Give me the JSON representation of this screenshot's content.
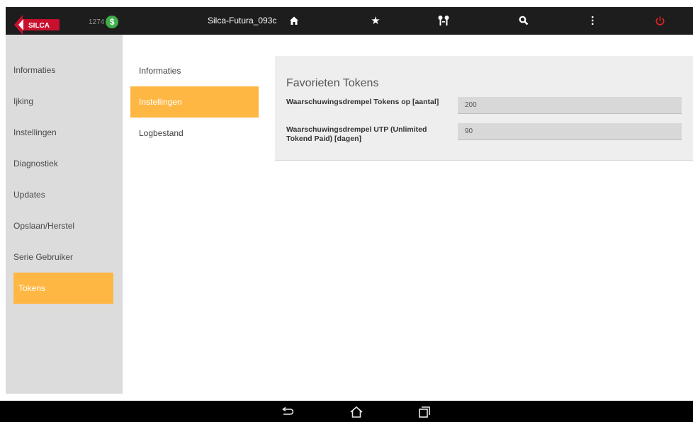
{
  "topbar": {
    "logo_text": "SILCA",
    "token_count": "1274",
    "coin_symbol": "$",
    "device_name": "Silca-Futura_093c",
    "icons": [
      "home-icon",
      "star-icon",
      "keys-icon",
      "search-icon",
      "more-vertical-icon",
      "power-icon"
    ],
    "glyphs": {
      "home": "🏠",
      "star": "★",
      "keys": "⚲⚲",
      "search": "🔍",
      "more": "⋮",
      "power": "⏻"
    },
    "power_color": "#e0221e"
  },
  "sidebar": {
    "items": [
      {
        "label": "Informaties"
      },
      {
        "label": "Ijking"
      },
      {
        "label": "Instellingen"
      },
      {
        "label": "Diagnostiek"
      },
      {
        "label": "Updates"
      },
      {
        "label": "Opslaan/Herstel"
      },
      {
        "label": "Serie Gebruiker"
      },
      {
        "label": "Tokens",
        "active": true
      }
    ]
  },
  "submenu": {
    "items": [
      {
        "label": "Informaties"
      },
      {
        "label": "Instellingen",
        "active": true
      },
      {
        "label": "Logbestand"
      }
    ]
  },
  "panel": {
    "title": "Favorieten Tokens",
    "fields": [
      {
        "label": "Waarschuwingsdrempel Tokens op [aantal]",
        "value": "200"
      },
      {
        "label": "Waarschuwingsdrempel UTP (Unlimited Tokend Paid) [dagen]",
        "value": "90"
      }
    ]
  },
  "navbar": {
    "glyphs": {
      "back": "⮌",
      "home": "⌂",
      "recents": "❐"
    }
  },
  "colors": {
    "accent": "#ffb743",
    "topbar": "#1d1d1d",
    "sidebar": "#dcdcdc",
    "coin": "#3db04a"
  }
}
